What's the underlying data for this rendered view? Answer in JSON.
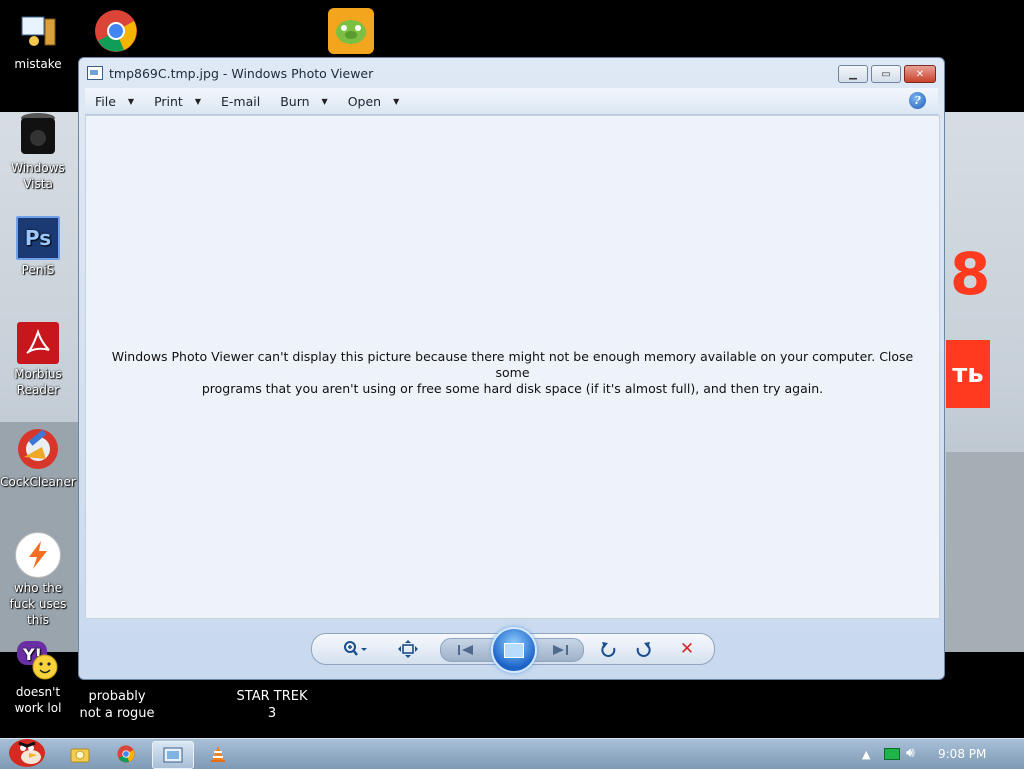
{
  "window": {
    "title": "tmp869C.tmp.jpg - Windows Photo Viewer",
    "menu": [
      {
        "label": "File",
        "has_caret": true
      },
      {
        "label": "Print",
        "has_caret": true
      },
      {
        "label": "E-mail",
        "has_caret": false
      },
      {
        "label": "Burn",
        "has_caret": true
      },
      {
        "label": "Open",
        "has_caret": true
      }
    ],
    "message_line1": "Windows Photo Viewer can't display this picture because there might not be enough memory available on your computer.  Close some",
    "message_line2": "programs that you aren't using or free some hard disk space (if it's almost full), and then try again.",
    "help_glyph": "?",
    "close_glyph": "✕",
    "maximize_glyph": "▭",
    "minimize_glyph": "▁"
  },
  "controls": {
    "zoom_icon": "zoom-icon",
    "fit_icon": "actual-size-icon",
    "prev_icon": "previous-icon",
    "next_icon": "next-icon",
    "rotate_ccw_icon": "rotate-counterclockwise-icon",
    "rotate_cw_icon": "rotate-clockwise-icon",
    "delete_glyph": "✕"
  },
  "desktop": {
    "icons": [
      {
        "label": "mistake",
        "icon": "computer-icon"
      },
      {
        "label": "",
        "icon": "chrome-icon"
      },
      {
        "label": "",
        "icon": "bad-piggies-icon"
      },
      {
        "label": "Windows Vista",
        "icon": "trash-icon"
      },
      {
        "label": "PeniS",
        "icon": "photoshop-icon"
      },
      {
        "label": "Morbius Reader",
        "icon": "pdf-reader-icon"
      },
      {
        "label": "CockCleaner",
        "icon": "ccleaner-icon"
      },
      {
        "label": "who the fuck uses this",
        "icon": "lightning-icon"
      },
      {
        "label": "doesn't work lol",
        "icon": "yahoo-messenger-icon"
      }
    ],
    "bottom_labels": [
      {
        "line1": "probably",
        "line2": "not a rogue"
      },
      {
        "line1": "STAR TREK",
        "line2": "3"
      }
    ],
    "wallpaper_sign_8": "8",
    "wallpaper_sign_tb": "ть"
  },
  "taskbar": {
    "clock": "9:08 PM",
    "items": [
      "start-orb-icon",
      "explorer-icon",
      "chrome-icon",
      "photo-viewer-icon",
      "vlc-icon"
    ]
  },
  "colors": {
    "accent": "#1d5db7",
    "close_red": "#c8422b",
    "viewer_bg": "#eef2f9",
    "delete_red": "#d02a2a"
  }
}
